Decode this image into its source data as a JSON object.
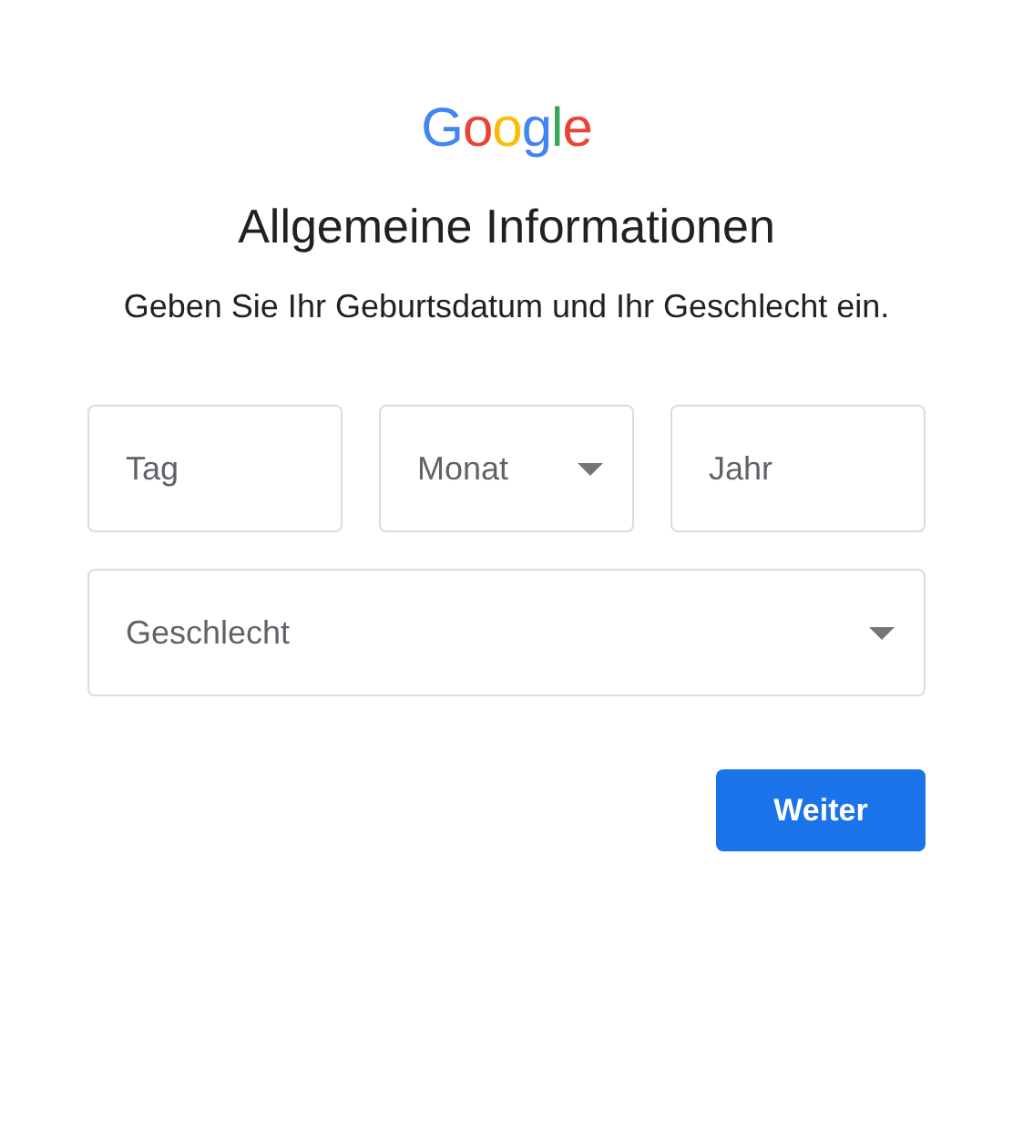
{
  "logo": "Google",
  "title": "Allgemeine Informationen",
  "subtitle": "Geben Sie Ihr Geburtsdatum und Ihr Geschlecht ein.",
  "date_fields": [
    {
      "kind": "text",
      "placeholder": "Tag"
    },
    {
      "kind": "select",
      "placeholder": "Monat"
    },
    {
      "kind": "text",
      "placeholder": "Jahr"
    }
  ],
  "gender_field": {
    "kind": "select",
    "placeholder": "Geschlecht"
  },
  "next_button": "Weiter"
}
